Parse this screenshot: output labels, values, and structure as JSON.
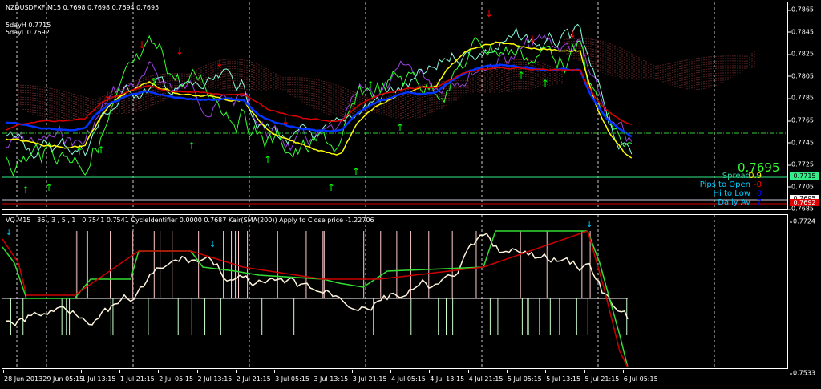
{
  "header": {
    "symbol_line": "NZDUSDFXF,M15  0.7698 0.7698 0.7694 0.7695",
    "five_day_high": "5dayH 0.7715",
    "five_day_low": "5dayL 0.7692"
  },
  "price_axis": [
    "0.7865",
    "0.7845",
    "0.7825",
    "0.7805",
    "0.7785",
    "0.7765",
    "0.7745",
    "0.7725",
    "0.7705",
    "0.7685"
  ],
  "price_badges": {
    "green": "0.7715",
    "white": "0.7695",
    "red": "0.7692"
  },
  "info_panel": {
    "price": "0.7695",
    "rows": [
      {
        "label": "Spread",
        "value": "0.9",
        "value_color": "#ffff00"
      },
      {
        "label": "Pips to Open",
        "value": "-0",
        "value_color": "#ff0000"
      },
      {
        "label": "Hi to Low",
        "value": "0",
        "value_color": "#0000ff"
      },
      {
        "label": "Daily Av",
        "value": "7",
        "value_color": "#0000ff"
      }
    ]
  },
  "indicator": {
    "header": "VQ M15 | 36 , 3 , 5 , 1 |  0.7541 0.7541  CycleIdentifier 0.0000 0.7687  Kair(SMA(200)) Apply to Close price -1.22706",
    "axis_top": "0.7724",
    "axis_bottom": "0.7533"
  },
  "time_axis": [
    "28 Jun 2013",
    "29 Jun 05:15",
    "1 Jul 13:15",
    "1 Jul 21:15",
    "2 Jul 05:15",
    "2 Jul 13:15",
    "2 Jul 21:15",
    "3 Jul 05:15",
    "3 Jul 13:15",
    "3 Jul 21:15",
    "4 Jul 05:15",
    "4 Jul 13:15",
    "4 Jul 21:15",
    "5 Jul 05:15",
    "5 Jul 13:15",
    "5 Jul 21:15",
    "6 Jul 05:15"
  ],
  "colors": {
    "up_arrow": "#00ff00",
    "down_arrow": "#ff0000",
    "price": "#33ff66",
    "accent_cyan": "#00ffff"
  }
}
